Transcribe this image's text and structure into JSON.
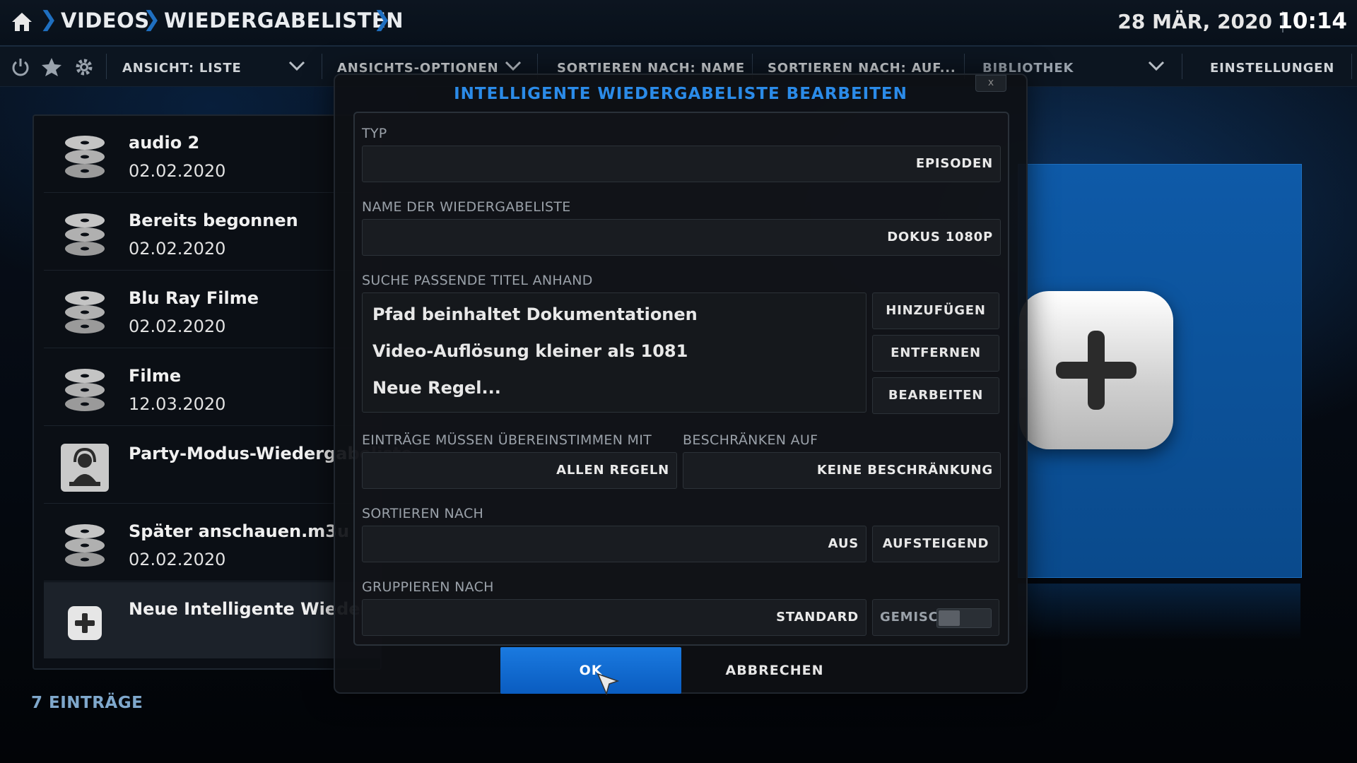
{
  "header": {
    "breadcrumb": [
      "VIDEOS",
      "WIEDERGABELISTEN"
    ],
    "date": "28 MÄR, 2020",
    "time": "10:14"
  },
  "toolbar": {
    "view": "ANSICHT: LISTE",
    "view_options": "ANSICHTS-OPTIONEN",
    "sort_by": "SORTIEREN NACH: NAME",
    "sort_order": "SORTIEREN NACH: AUF...",
    "library": "BIBLIOTHEK",
    "settings": "EINSTELLUNGEN",
    "icons": [
      "power-icon",
      "star-icon",
      "gear-icon"
    ]
  },
  "list": {
    "items": [
      {
        "title": "audio 2",
        "date": "02.02.2020",
        "icon": "disc-stack-icon"
      },
      {
        "title": "Bereits begonnen",
        "date": "02.02.2020",
        "icon": "disc-stack-icon"
      },
      {
        "title": "Blu Ray Filme",
        "date": "02.02.2020",
        "icon": "disc-stack-icon"
      },
      {
        "title": "Filme",
        "date": "12.03.2020",
        "icon": "disc-stack-icon"
      },
      {
        "title": "Party-Modus-Wiedergabeliste",
        "date": "",
        "icon": "party-dj-icon"
      },
      {
        "title": "Später anschauen.m3u",
        "date": "02.02.2020",
        "icon": "disc-stack-icon"
      },
      {
        "title": "Neue Intelligente Wiedergabeliste...",
        "date": "",
        "icon": "add-icon"
      }
    ],
    "count_label": "7 EINTRÄGE"
  },
  "dialog": {
    "title": "INTELLIGENTE WIEDERGABELISTE BEARBEITEN",
    "close": "x",
    "type_label": "TYP",
    "type_value": "EPISODEN",
    "name_label": "NAME DER WIEDERGABELISTE",
    "name_value": "DOKUS 1080P",
    "rules_label": "SUCHE PASSENDE TITEL ANHAND",
    "rules": [
      "Pfad beinhaltet Dokumentationen",
      "Video-Auflösung kleiner als 1081",
      "Neue Regel..."
    ],
    "add_label": "HINZUFÜGEN",
    "remove_label": "ENTFERNEN",
    "edit_label": "BEARBEITEN",
    "match_label": "EINTRÄGE MÜSSEN ÜBEREINSTIMMEN MIT",
    "match_value": "ALLEN REGELN",
    "limit_label": "BESCHRÄNKEN AUF",
    "limit_value": "KEINE BESCHRÄNKUNG",
    "sort_label": "SORTIEREN NACH",
    "sort_value": "AUS",
    "sort_dir": "AUFSTEIGEND",
    "group_label": "GRUPPIEREN NACH",
    "group_value": "STANDARD",
    "mixed_label": "GEMISCHT",
    "mixed_on": false,
    "ok_label": "OK",
    "cancel_label": "ABBRECHEN"
  },
  "colors": {
    "accent": "#1f6fc0",
    "title_blue": "#2b8be8",
    "ok_button": "#1a7ae0"
  }
}
